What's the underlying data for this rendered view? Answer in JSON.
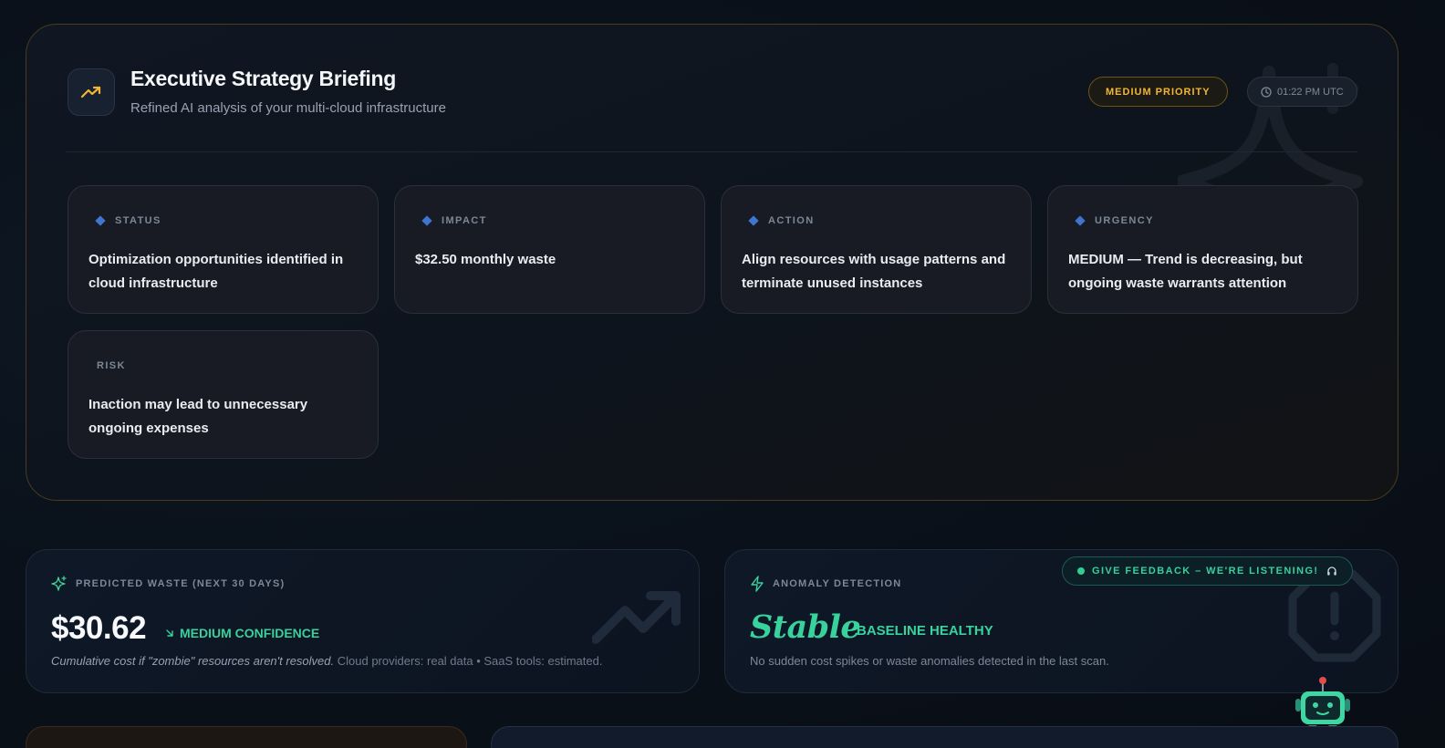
{
  "briefing": {
    "title": "Executive Strategy Briefing",
    "subtitle": "Refined AI analysis of your multi-cloud infrastructure",
    "priority": "MEDIUM PRIORITY",
    "time": "01:22 PM UTC",
    "cards": [
      {
        "label": "STATUS",
        "text": "Optimization opportunities identified in cloud infrastructure"
      },
      {
        "label": "IMPACT",
        "text": "$32.50 monthly waste"
      },
      {
        "label": "ACTION",
        "text": "Align resources with usage patterns and terminate unused instances"
      },
      {
        "label": "URGENCY",
        "text": "MEDIUM — Trend is decreasing, but ongoing waste warrants attention"
      },
      {
        "label": "RISK",
        "text": "Inaction may lead to unnecessary ongoing expenses"
      }
    ]
  },
  "waste": {
    "label": "PREDICTED WASTE (NEXT 30 DAYS)",
    "value": "$30.62",
    "confidence": "MEDIUM CONFIDENCE",
    "note_em": "Cumulative cost if \"zombie\" resources aren't resolved.",
    "note_rest": "Cloud providers: real data • SaaS tools: estimated."
  },
  "anomaly": {
    "label": "ANOMALY DETECTION",
    "status": "Stable",
    "baseline": "BASELINE HEALTHY",
    "note": "No sudden cost spikes or waste anomalies detected in the last scan."
  },
  "feedback": {
    "label": "GIVE FEEDBACK – WE'RE LISTENING!"
  },
  "colors": {
    "accent_gold": "#f2b535",
    "accent_green": "#38d29d",
    "accent_blue": "#3f74cf"
  },
  "icons": [
    "trending-up-icon",
    "clock-icon",
    "sparkle-icon",
    "sparkles-icon",
    "trend-down-icon",
    "bolt-icon",
    "alert-octagon-icon",
    "headphones-icon",
    "robot-icon"
  ]
}
